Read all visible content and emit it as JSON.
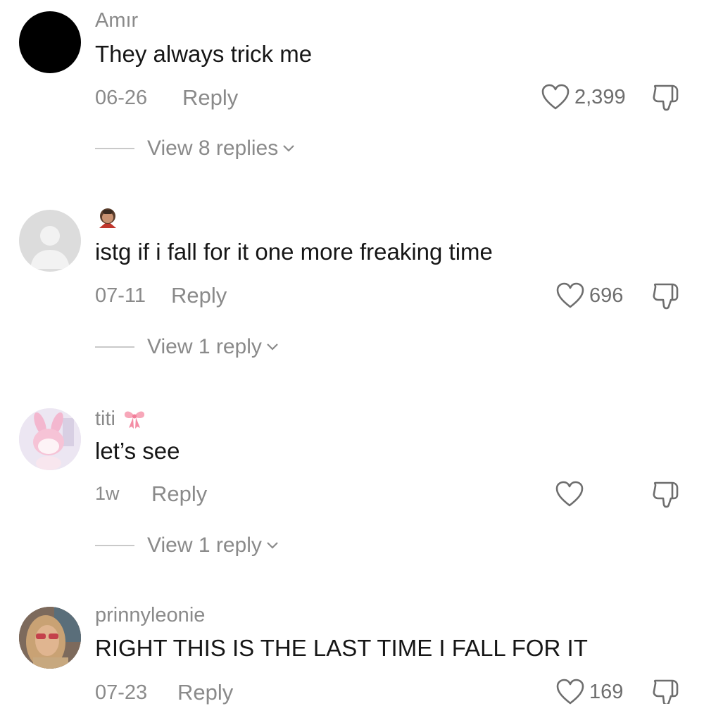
{
  "comments": [
    {
      "username": "Amır",
      "text": "They always trick me",
      "date": "06-26",
      "reply_label": "Reply",
      "likes": "2,399",
      "view_replies": "View 8 replies"
    },
    {
      "username": "",
      "text": "istg if i fall for it one more freaking time",
      "date": "07-11",
      "reply_label": "Reply",
      "likes": "696",
      "view_replies": "View 1 reply"
    },
    {
      "username": "titi",
      "text": "let’s see",
      "date": "1w",
      "reply_label": "Reply",
      "likes": "",
      "view_replies": "View 1 reply"
    },
    {
      "username": "prinnyleonie",
      "text": "RIGHT THIS IS THE LAST TIME I FALL FOR IT",
      "date": "07-23",
      "reply_label": "Reply",
      "likes": "169"
    }
  ],
  "icons": {
    "like": "heart-icon",
    "dislike": "thumbs-down-icon",
    "expand": "chevron-down-icon"
  },
  "colors": {
    "text": "#161616",
    "muted": "#8a8a8a"
  }
}
